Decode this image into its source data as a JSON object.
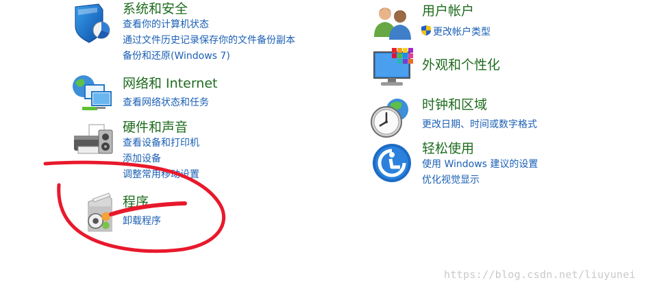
{
  "categories": {
    "system_security": {
      "title": "系统和安全",
      "icon": "shield-icon",
      "links": [
        "查看你的计算机状态",
        "通过文件历史记录保存你的文件备份副本",
        "备份和还原(Windows 7)"
      ]
    },
    "network": {
      "title": "网络和 Internet",
      "icon": "network-globe-icon",
      "links": [
        "查看网络状态和任务"
      ]
    },
    "hardware_sound": {
      "title": "硬件和声音",
      "icon": "printer-icon",
      "links": [
        "查看设备和打印机",
        "添加设备",
        "调整常用移动设置"
      ]
    },
    "programs": {
      "title": "程序",
      "icon": "programs-disc-icon",
      "links": [
        "卸载程序"
      ]
    },
    "user_accounts": {
      "title": "用户帐户",
      "icon": "users-icon",
      "links": [
        "更改帐户类型"
      ],
      "link_icon": "uac-shield-icon"
    },
    "appearance": {
      "title": "外观和个性化",
      "icon": "monitor-palette-icon",
      "links": []
    },
    "clock_region": {
      "title": "时钟和区域",
      "icon": "clock-globe-icon",
      "links": [
        "更改日期、时间或数字格式"
      ]
    },
    "ease_of_access": {
      "title": "轻松使用",
      "icon": "ease-of-access-icon",
      "links": [
        "使用 Windows 建议的设置",
        "优化视觉显示"
      ]
    }
  },
  "watermark": "https://blog.csdn.net/liuyunei",
  "colors": {
    "title_green": "#1e6b1e",
    "link_blue": "#1a5fb4",
    "annotation_red": "#e8192c",
    "watermark_gray": "#c9c9c9"
  }
}
